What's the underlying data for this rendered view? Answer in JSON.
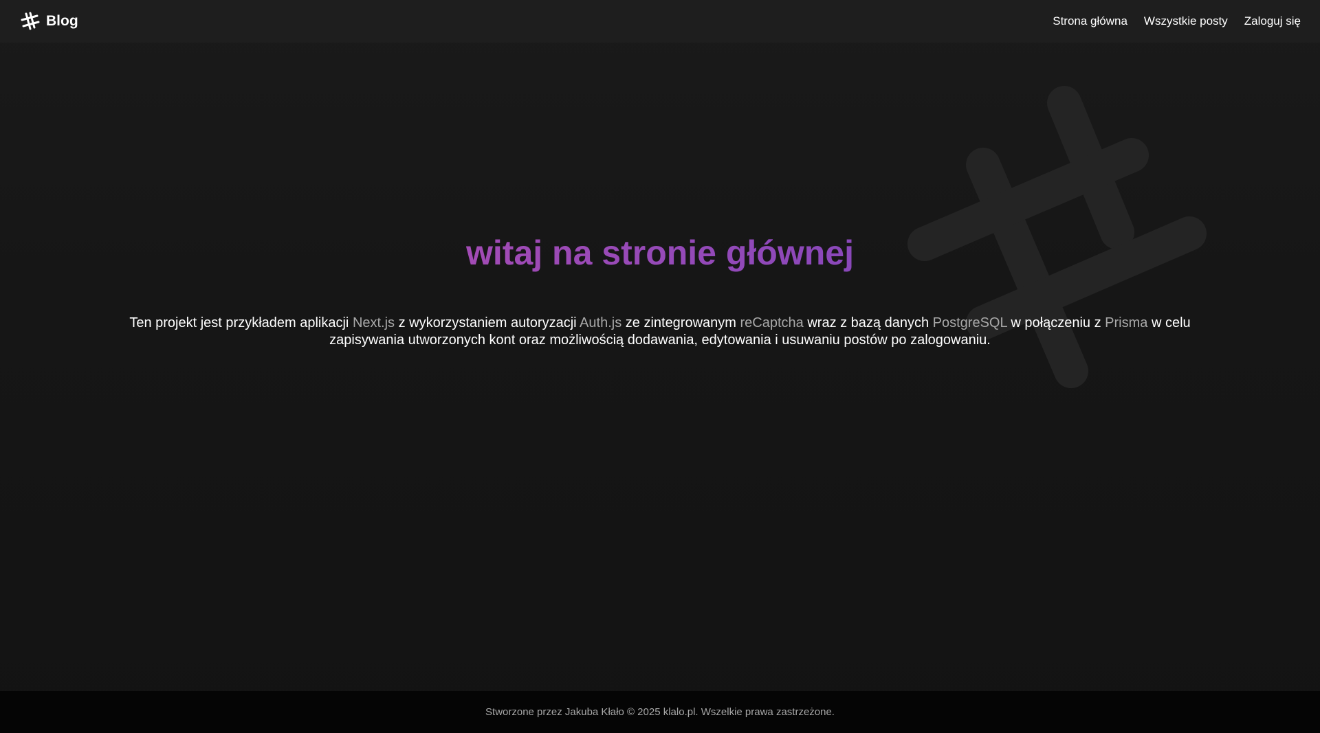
{
  "header": {
    "brand_icon": "hashtag-icon",
    "brand_label": "Blog",
    "nav": [
      {
        "label": "Strona główna"
      },
      {
        "label": "Wszystkie posty"
      },
      {
        "label": "Zaloguj się"
      }
    ]
  },
  "background": {
    "watermark_icon": "hashtag-icon"
  },
  "hero": {
    "title": "witaj na stronie głównej",
    "desc_parts": [
      "Ten projekt jest przykładem aplikacji ",
      "Next.js",
      " z wykorzystaniem autoryzacji ",
      "Auth.js",
      " ze zintegrowanym ",
      "reCaptcha",
      " wraz z bazą danych ",
      "PostgreSQL",
      " w połączeniu z ",
      "Prisma",
      " w celu zapisywania utworzonych kont oraz możliwością dodawania, edytowania i usuwaniu postów po zalogowaniu."
    ]
  },
  "footer": {
    "text": "Stworzone przez Jakuba Kłało © 2025 klalo.pl. Wszelkie prawa zastrzeżone."
  },
  "colors": {
    "title_gradient_start": "#a24bb5",
    "title_gradient_end": "#8a48ba",
    "highlight_text": "#a9a9a9",
    "background": "#161616",
    "header_bg": "#1e1e1e",
    "footer_bg": "#050505"
  }
}
